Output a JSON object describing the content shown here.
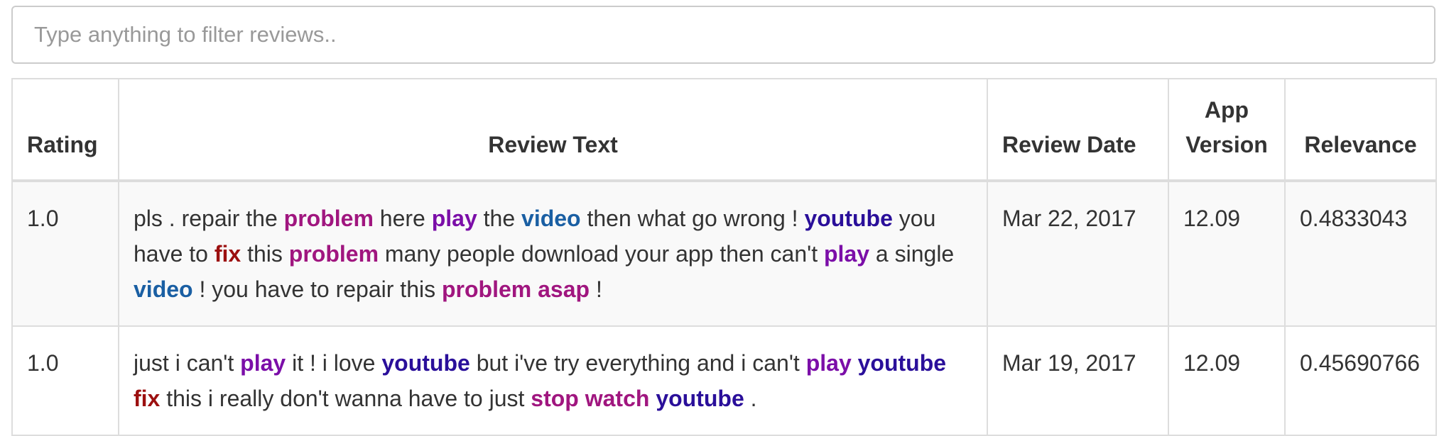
{
  "filter": {
    "placeholder": "Type anything to filter reviews.."
  },
  "table": {
    "headers": {
      "rating": "Rating",
      "review_text": "Review Text",
      "review_date": "Review Date",
      "app_version": "App Version",
      "relevance": "Relevance"
    },
    "rows": [
      {
        "rating": "1.0",
        "review_date": "Mar 22, 2017",
        "app_version": "12.09",
        "relevance": "0.4833043",
        "text_segments": [
          {
            "t": "pls . repair the "
          },
          {
            "t": "problem",
            "color": "#a0167f"
          },
          {
            "t": " here "
          },
          {
            "t": "play",
            "color": "#7b0ea8"
          },
          {
            "t": " the "
          },
          {
            "t": "video",
            "color": "#1a5fa3"
          },
          {
            "t": " then what go wrong ! "
          },
          {
            "t": "youtube",
            "color": "#2a0f9a"
          },
          {
            "t": " you have to "
          },
          {
            "t": "fix",
            "color": "#9c1010"
          },
          {
            "t": " this "
          },
          {
            "t": "problem",
            "color": "#a0167f"
          },
          {
            "t": " many people download your app then can't "
          },
          {
            "t": "play",
            "color": "#7b0ea8"
          },
          {
            "t": " a single "
          },
          {
            "t": "video",
            "color": "#1a5fa3"
          },
          {
            "t": " ! you have to repair this "
          },
          {
            "t": "problem",
            "color": "#a0167f"
          },
          {
            "t": " "
          },
          {
            "t": "asap",
            "color": "#a0167f"
          },
          {
            "t": " !"
          }
        ]
      },
      {
        "rating": "1.0",
        "review_date": "Mar 19, 2017",
        "app_version": "12.09",
        "relevance": "0.45690766",
        "text_segments": [
          {
            "t": "just i can't "
          },
          {
            "t": "play",
            "color": "#7b0ea8"
          },
          {
            "t": " it ! i love "
          },
          {
            "t": "youtube",
            "color": "#2a0f9a"
          },
          {
            "t": " but i've try everything and i can't "
          },
          {
            "t": "play",
            "color": "#7b0ea8"
          },
          {
            "t": " "
          },
          {
            "t": "youtube",
            "color": "#2a0f9a"
          },
          {
            "t": " "
          },
          {
            "t": "fix",
            "color": "#9c1010"
          },
          {
            "t": " this i really don't wanna have to just "
          },
          {
            "t": "stop",
            "color": "#a0167f"
          },
          {
            "t": " "
          },
          {
            "t": "watch",
            "color": "#a0167f"
          },
          {
            "t": " "
          },
          {
            "t": "youtube",
            "color": "#2a0f9a"
          },
          {
            "t": " ."
          }
        ]
      }
    ]
  }
}
